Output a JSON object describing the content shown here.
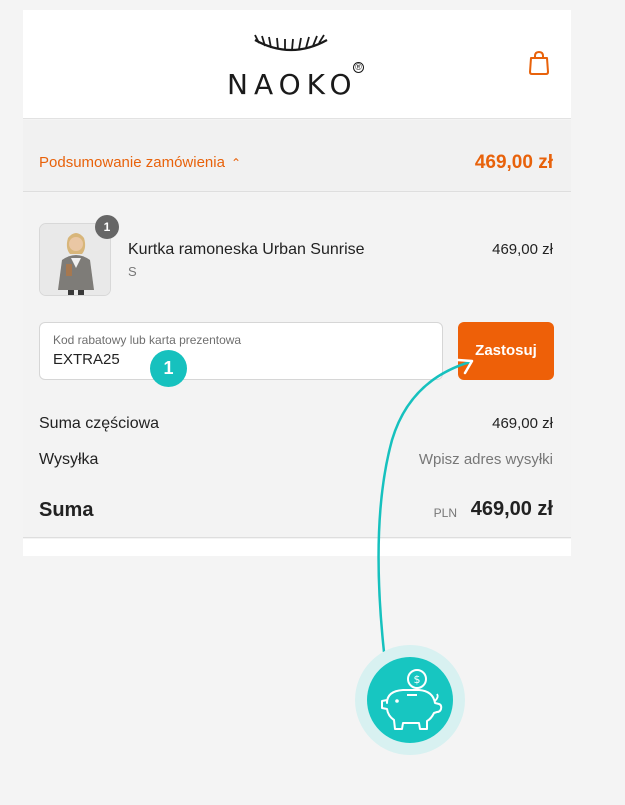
{
  "header": {
    "brand": "NAOKO",
    "brand_mark": "®",
    "cart_icon": "shopping-bag-icon"
  },
  "summary": {
    "toggle_label": "Podsumowanie zamówienia",
    "toggle_icon": "chevron-up-icon",
    "total": "469,00 zł"
  },
  "cart": {
    "items": [
      {
        "name": "Kurtka ramoneska Urban Sunrise",
        "variant": "S",
        "price": "469,00 zł",
        "quantity": "1"
      }
    ]
  },
  "discount": {
    "label": "Kod rabatowy lub karta prezentowa",
    "value": "EXTRA25",
    "apply_label": "Zastosuj"
  },
  "totals": {
    "subtotal_label": "Suma częściowa",
    "subtotal_value": "469,00 zł",
    "shipping_label": "Wysyłka",
    "shipping_value": "Wpisz adres wysyłki",
    "total_label": "Suma",
    "currency": "PLN",
    "total_value": "469,00 zł"
  },
  "annotation": {
    "step_number": "1",
    "badge_icon": "piggy-bank-coin-icon"
  },
  "colors": {
    "accent": "#ee6008",
    "annotation": "#16c1be"
  }
}
